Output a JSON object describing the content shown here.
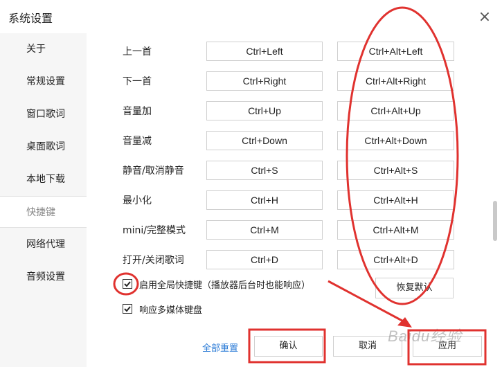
{
  "window": {
    "title": "系统设置"
  },
  "sidebar": {
    "items": [
      {
        "label": "关于"
      },
      {
        "label": "常规设置"
      },
      {
        "label": "窗口歌词"
      },
      {
        "label": "桌面歌词"
      },
      {
        "label": "本地下载"
      },
      {
        "label": "快捷键",
        "active": true
      },
      {
        "label": "网络代理"
      },
      {
        "label": "音频设置"
      }
    ]
  },
  "shortcuts": [
    {
      "label": "上一首",
      "local": "Ctrl+Left",
      "global": "Ctrl+Alt+Left"
    },
    {
      "label": "下一首",
      "local": "Ctrl+Right",
      "global": "Ctrl+Alt+Right"
    },
    {
      "label": "音量加",
      "local": "Ctrl+Up",
      "global": "Ctrl+Alt+Up"
    },
    {
      "label": "音量减",
      "local": "Ctrl+Down",
      "global": "Ctrl+Alt+Down"
    },
    {
      "label": "静音/取消静音",
      "local": "Ctrl+S",
      "global": "Ctrl+Alt+S"
    },
    {
      "label": "最小化",
      "local": "Ctrl+H",
      "global": "Ctrl+Alt+H"
    },
    {
      "label": "mini/完整模式",
      "local": "Ctrl+M",
      "global": "Ctrl+Alt+M"
    },
    {
      "label": "打开/关闭歌词",
      "local": "Ctrl+D",
      "global": "Ctrl+Alt+D"
    }
  ],
  "options": {
    "global_hotkey": {
      "label": "启用全局快捷键（播放器后台时也能响应）",
      "checked": true
    },
    "media_keys": {
      "label": "响应多媒体键盘",
      "checked": true
    }
  },
  "buttons": {
    "restore_default": "恢复默认",
    "reset_all": "全部重置",
    "confirm": "确认",
    "cancel": "取消",
    "apply": "应用"
  },
  "annotation": {
    "color": "#e0322f"
  },
  "watermark": {
    "text": "Baidu经验"
  }
}
